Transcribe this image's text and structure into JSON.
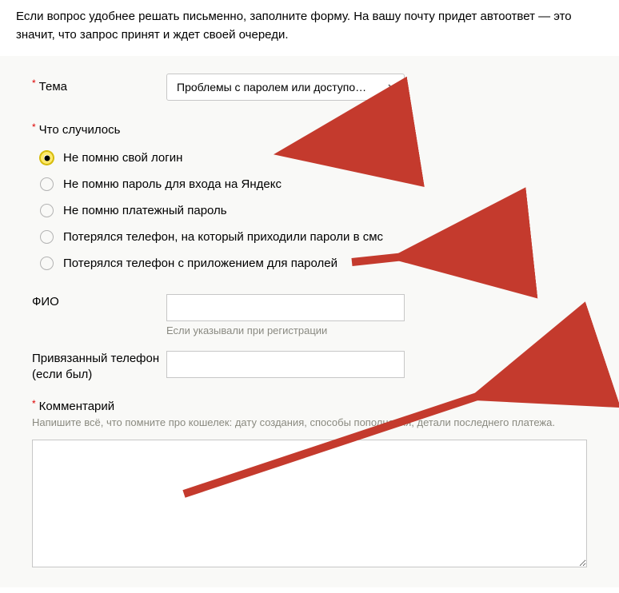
{
  "intro": "Если вопрос удобнее решать письменно, заполните форму. На вашу почту придет автоответ — это значит, что запрос принят и ждет своей очереди.",
  "theme": {
    "label": "Тема",
    "selected": "Проблемы с паролем или доступо…"
  },
  "what_happened": {
    "label": "Что случилось",
    "options": [
      "Не помню свой логин",
      "Не помню пароль для входа на Яндекс",
      "Не помню платежный пароль",
      "Потерялся телефон, на который приходили пароли в смс",
      "Потерялся телефон с приложением для паролей"
    ],
    "selected_index": 0
  },
  "fio": {
    "label": "ФИО",
    "hint": "Если указывали при регистрации",
    "value": ""
  },
  "phone": {
    "label": "Привязанный телефон (если был)",
    "value": ""
  },
  "comment": {
    "label": "Комментарий",
    "hint": "Напишите всё, что помните про кошелек: дату создания, способы пополнения, детали последнего платежа.",
    "value": ""
  }
}
